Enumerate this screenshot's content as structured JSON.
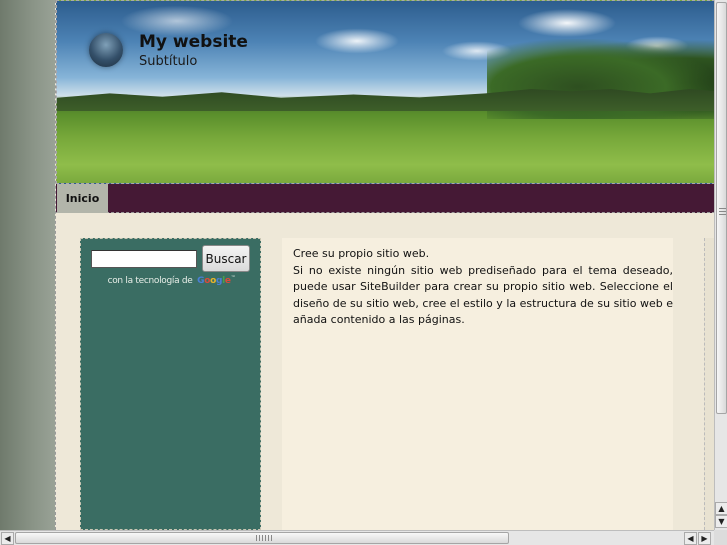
{
  "header": {
    "site_title": "My website",
    "site_subtitle": "Subtítulo"
  },
  "nav": {
    "items": [
      {
        "label": "Inicio",
        "active": true
      }
    ]
  },
  "sidebar": {
    "search_value": "",
    "search_button": "Buscar",
    "powered_by": "con la tecnología de",
    "powered_brand": "Google"
  },
  "content": {
    "lines": [
      "Cree su propio sitio web.",
      "Si no existe ningún sitio web prediseñado para el tema deseado, puede usar SiteBuilder para crear su propio sitio web. Seleccione el diseño de su sitio web, cree el estilo y la estructura de su sitio web e añada contenido a las páginas."
    ]
  },
  "colors": {
    "nav_bar": "#451935",
    "nav_active": "#b2b5aa",
    "sidebar": "#3a6d63",
    "page_bg": "#eee8d8",
    "content_bg": "#f6efdf"
  },
  "icons": {
    "logo": "sphere-logo-icon",
    "scroll_up": "arrow-up-icon",
    "scroll_down": "arrow-down-icon",
    "scroll_left": "arrow-left-icon",
    "scroll_right": "arrow-right-icon"
  }
}
